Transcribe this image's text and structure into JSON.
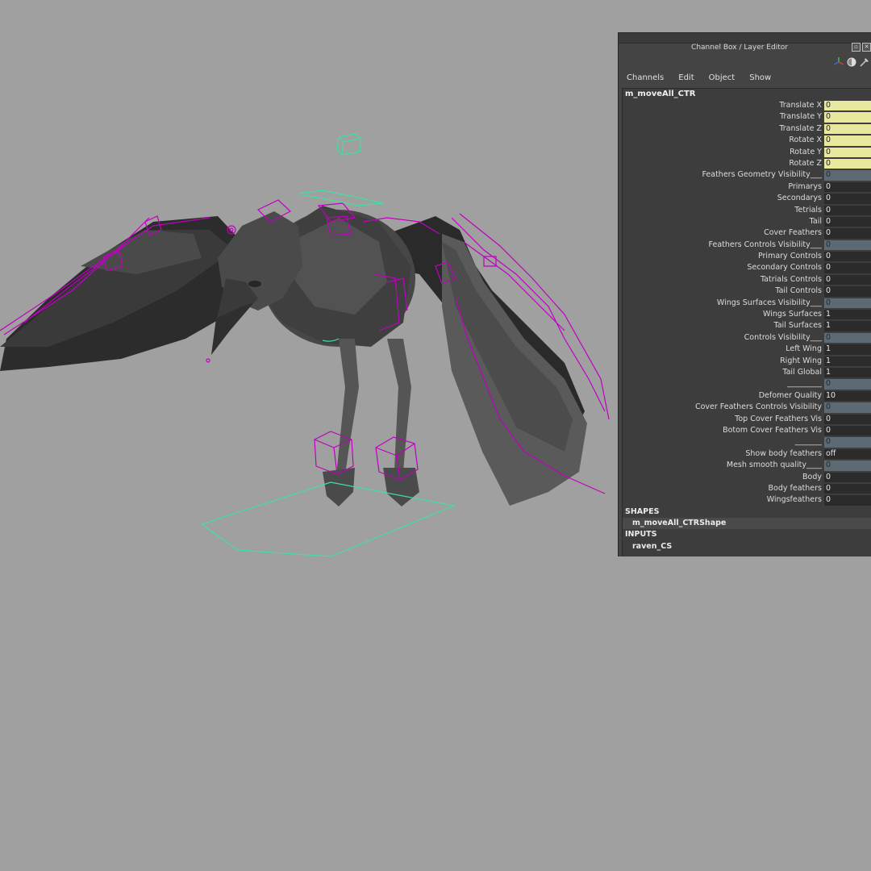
{
  "panel": {
    "title": "Channel Box / Layer Editor",
    "menus": [
      "Channels",
      "Edit",
      "Object",
      "Show"
    ],
    "object_name": "m_moveAll_CTR",
    "attributes": [
      {
        "label": "Translate X",
        "value": "0",
        "style": "keyable"
      },
      {
        "label": "Translate Y",
        "value": "0",
        "style": "keyable"
      },
      {
        "label": "Translate Z",
        "value": "0",
        "style": "keyable"
      },
      {
        "label": "Rotate X",
        "value": "0",
        "style": "keyable"
      },
      {
        "label": "Rotate Y",
        "value": "0",
        "style": "keyable"
      },
      {
        "label": "Rotate Z",
        "value": "0",
        "style": "keyable"
      },
      {
        "label": "Feathers Geometry Visibility___",
        "value": "0",
        "style": "locked"
      },
      {
        "label": "Primarys",
        "value": "0",
        "style": "normal"
      },
      {
        "label": "Secondarys",
        "value": "0",
        "style": "normal"
      },
      {
        "label": "Tetrials",
        "value": "0",
        "style": "normal"
      },
      {
        "label": "Tail",
        "value": "0",
        "style": "normal"
      },
      {
        "label": "Cover Feathers",
        "value": "0",
        "style": "normal"
      },
      {
        "label": "Feathers Controls Visibility___",
        "value": "0",
        "style": "locked"
      },
      {
        "label": "Primary Controls",
        "value": "0",
        "style": "normal"
      },
      {
        "label": "Secondary Controls",
        "value": "0",
        "style": "normal"
      },
      {
        "label": "Tatrials Controls",
        "value": "0",
        "style": "normal"
      },
      {
        "label": "Tail Controls",
        "value": "0",
        "style": "normal"
      },
      {
        "label": "Wings Surfaces Visibility___",
        "value": "0",
        "style": "locked"
      },
      {
        "label": "Wings Surfaces",
        "value": "1",
        "style": "normal"
      },
      {
        "label": "Tail Surfaces",
        "value": "1",
        "style": "normal"
      },
      {
        "label": "Controls Visibility___",
        "value": "0",
        "style": "locked"
      },
      {
        "label": "Left Wing",
        "value": "1",
        "style": "normal"
      },
      {
        "label": "Right Wing",
        "value": "1",
        "style": "normal"
      },
      {
        "label": "Tail Global",
        "value": "1",
        "style": "normal"
      },
      {
        "label": "_________",
        "value": "0",
        "style": "locked"
      },
      {
        "label": "Defomer Quality",
        "value": "10",
        "style": "normal"
      },
      {
        "label": "Cover Feathers Controls Visibility",
        "value": "0",
        "style": "locked"
      },
      {
        "label": "Top Cover Feathers Vis",
        "value": "0",
        "style": "normal"
      },
      {
        "label": "Botom Cover Feathers Vis",
        "value": "0",
        "style": "normal"
      },
      {
        "label": "_______",
        "value": "0",
        "style": "locked"
      },
      {
        "label": "Show body feathers",
        "value": "off",
        "style": "normal"
      },
      {
        "label": "Mesh smooth quality____",
        "value": "0",
        "style": "locked"
      },
      {
        "label": "Body",
        "value": "0",
        "style": "normal"
      },
      {
        "label": "Body feathers",
        "value": "0",
        "style": "normal"
      },
      {
        "label": "Wingsfeathers",
        "value": "0",
        "style": "normal"
      }
    ],
    "shapes_header": "SHAPES",
    "shape_node": "m_moveAll_CTRShape",
    "inputs_header": "INPUTS",
    "input_node": "raven_CS"
  },
  "colors": {
    "viewport_bg": "#a0a0a0",
    "control_magenta": "#c000c0",
    "control_green": "#40e0a0",
    "keyable_field": "#e8e89e",
    "locked_field": "#5d6a73"
  },
  "icons": [
    "float-icon",
    "close-icon",
    "axis-icon",
    "shading-icon",
    "pin-icon"
  ]
}
